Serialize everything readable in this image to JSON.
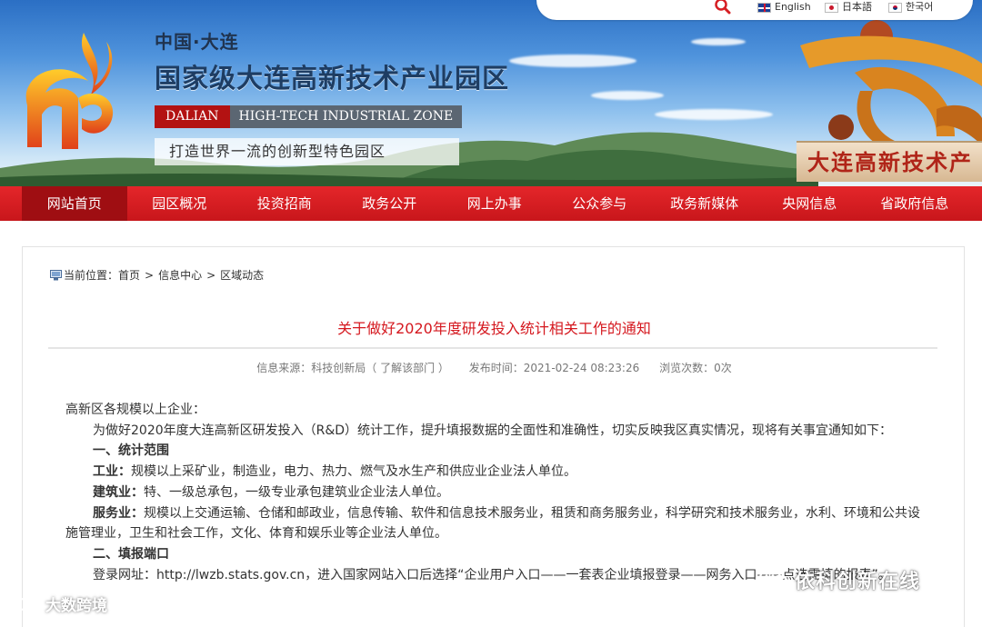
{
  "header": {
    "city": "中国·大连",
    "title": "国家级大连高新技术产业园区",
    "en_dalian": "DALIAN",
    "en_zone": "HIGH-TECH INDUSTRIAL ZONE",
    "slogan": "打造世界一流的创新型特色园区",
    "sign_text": "大连高新技术产",
    "languages": [
      {
        "label": "English",
        "flag": "uk-flag-icon"
      },
      {
        "label": "日本語",
        "flag": "japan-flag-icon"
      },
      {
        "label": "한국어",
        "flag": "korea-flag-icon"
      }
    ],
    "colors": {
      "nav_red": "#d61e23",
      "title_red": "#d5181f",
      "brand_orange": "#f08a12"
    }
  },
  "nav": {
    "items": [
      "网站首页",
      "园区概况",
      "投资招商",
      "政务公开",
      "网上办事",
      "公众参与",
      "政务新媒体",
      "央网信息",
      "省政府信息"
    ],
    "active_index": 0
  },
  "breadcrumb": {
    "prefix": "当前位置：",
    "items": [
      "首页",
      "信息中心",
      "区域动态"
    ],
    "separator": ">"
  },
  "article": {
    "title": "关于做好2020年度研发投入统计相关工作的通知",
    "source_label": "信息来源：",
    "source": "科技创新局",
    "dept_link": "（ 了解该部门 ）",
    "time_label": "发布时间：",
    "time": "2021-02-24 08:23:26",
    "views_label": "浏览次数：",
    "views": "0次",
    "salutation": "高新区各规模以上企业：",
    "intro": "为做好2020年度大连高新区研发投入（R&D）统计工作，提升填报数据的全面性和准确性，切实反映我区真实情况，现将有关事宜通知如下：",
    "section1": "一、统计范围",
    "industry_label": "工业：",
    "industry_text": "规模以上采矿业，制造业，电力、热力、燃气及水生产和供应业企业法人单位。",
    "construction_label": "建筑业：",
    "construction_text": "特、一级总承包，一级专业承包建筑业企业法人单位。",
    "service_label": "服务业：",
    "service_text": "规模以上交通运输、仓储和邮政业，信息传输、软件和信息技术服务业，租赁和商务服务业，科学研究和技术服务业，水利、环境和公共设施管理业，卫生和社会工作，文化、体育和娱乐业等企业法人单位。",
    "section2": "二、填报端口",
    "login_label": "登录网址：",
    "login_url": "http://lwzb.stats.gov.cn",
    "login_text": "，进入国家网站入口后选择“企业用户入口——一套表企业填报登录——网务入口——点选需填的报表”。"
  },
  "watermarks": {
    "right": "依科创新在线",
    "left": "大数跨境"
  }
}
